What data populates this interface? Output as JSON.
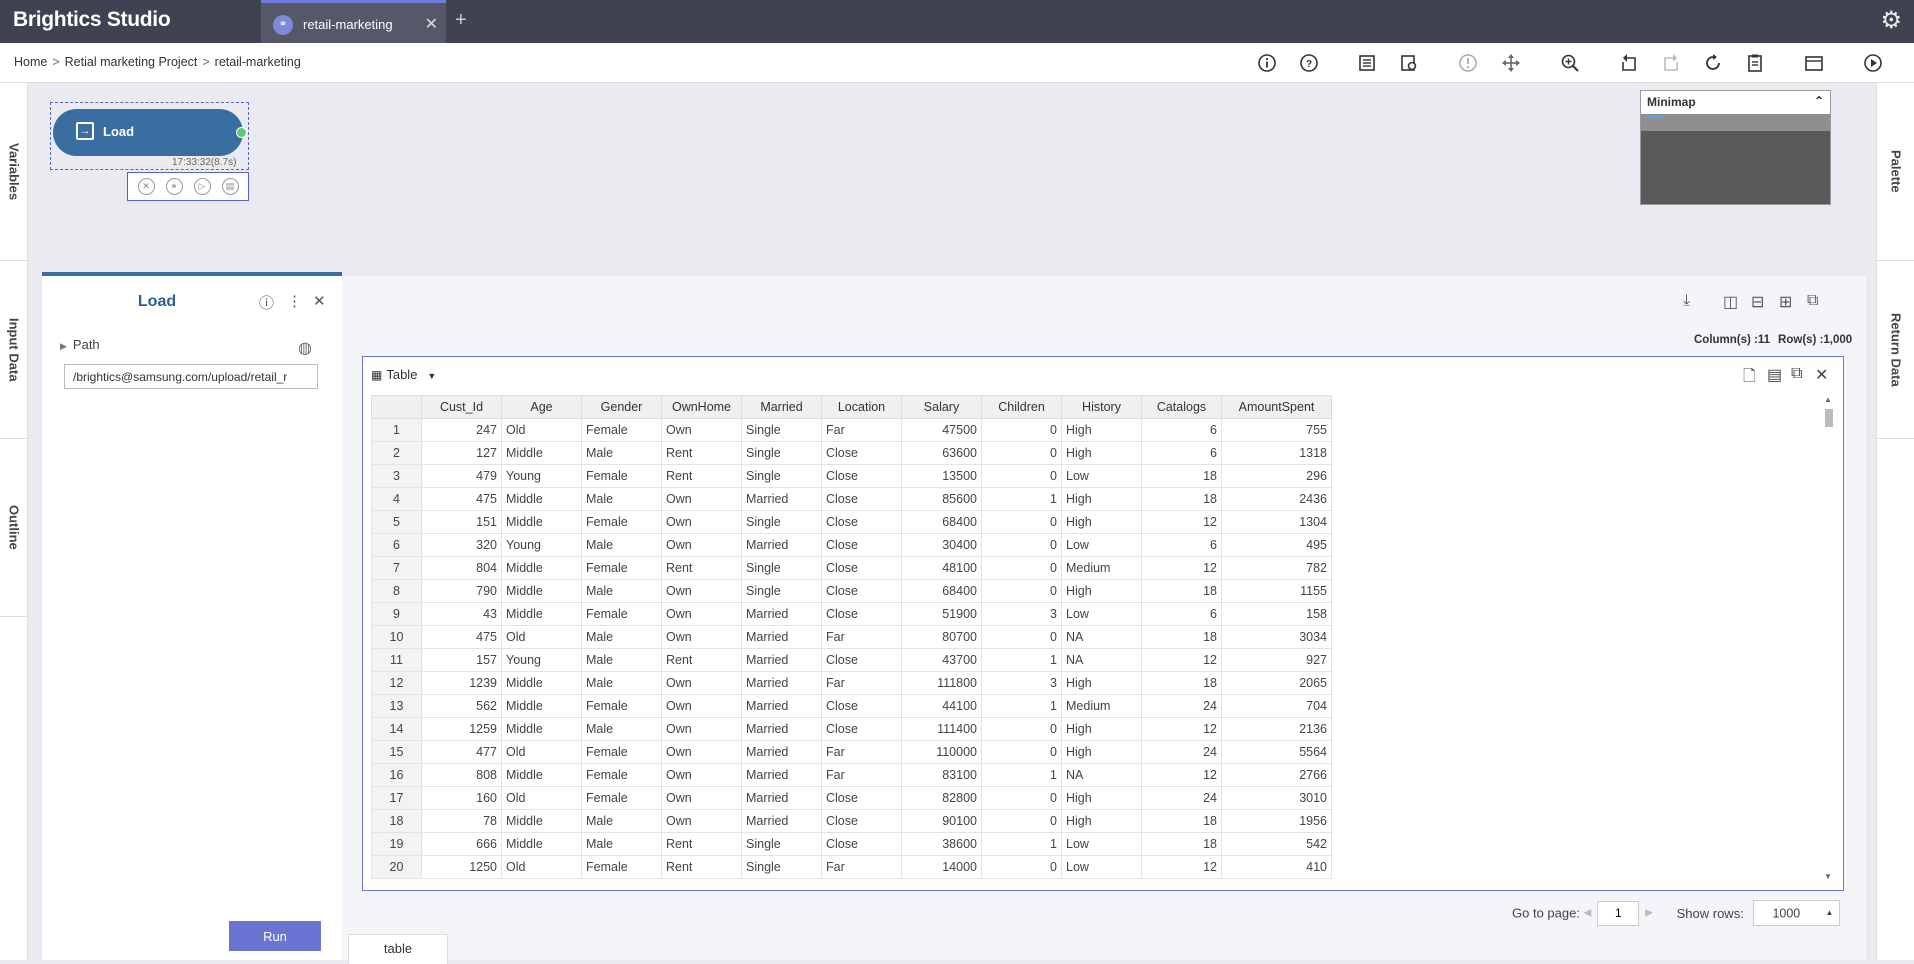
{
  "app": {
    "title": "Brightics Studio"
  },
  "tabs": [
    {
      "label": "retail-marketing",
      "icon": "workflow-icon"
    }
  ],
  "breadcrumb": {
    "home": "Home",
    "project": "Retial marketing Project",
    "current": "retail-marketing"
  },
  "left_rail": [
    "Variables",
    "Input Data",
    "Outline"
  ],
  "right_rail": [
    "Palette",
    "Return Data"
  ],
  "node": {
    "label": "Load",
    "time": "17:33:32(8.7s)"
  },
  "minimap": {
    "title": "Minimap"
  },
  "load_panel": {
    "title": "Load",
    "path_label": "Path",
    "path_value": "/brightics@samsung.com/upload/retail_r",
    "run_label": "Run"
  },
  "result": {
    "columns_label": "Column(s) :11",
    "rows_label": "Row(s) :1,000",
    "view_label": "Table",
    "goto_label": "Go to page:",
    "page_value": "1",
    "show_rows_label": "Show rows:",
    "show_rows_value": "1000",
    "bottom_tab": "table"
  },
  "table": {
    "columns": [
      "Cust_Id",
      "Age",
      "Gender",
      "OwnHome",
      "Married",
      "Location",
      "Salary",
      "Children",
      "History",
      "Catalogs",
      "AmountSpent"
    ],
    "rows": [
      [
        "1",
        "247",
        "Old",
        "Female",
        "Own",
        "Single",
        "Far",
        "47500",
        "0",
        "High",
        "6",
        "755"
      ],
      [
        "2",
        "127",
        "Middle",
        "Male",
        "Rent",
        "Single",
        "Close",
        "63600",
        "0",
        "High",
        "6",
        "1318"
      ],
      [
        "3",
        "479",
        "Young",
        "Female",
        "Rent",
        "Single",
        "Close",
        "13500",
        "0",
        "Low",
        "18",
        "296"
      ],
      [
        "4",
        "475",
        "Middle",
        "Male",
        "Own",
        "Married",
        "Close",
        "85600",
        "1",
        "High",
        "18",
        "2436"
      ],
      [
        "5",
        "151",
        "Middle",
        "Female",
        "Own",
        "Single",
        "Close",
        "68400",
        "0",
        "High",
        "12",
        "1304"
      ],
      [
        "6",
        "320",
        "Young",
        "Male",
        "Own",
        "Married",
        "Close",
        "30400",
        "0",
        "Low",
        "6",
        "495"
      ],
      [
        "7",
        "804",
        "Middle",
        "Female",
        "Rent",
        "Single",
        "Close",
        "48100",
        "0",
        "Medium",
        "12",
        "782"
      ],
      [
        "8",
        "790",
        "Middle",
        "Male",
        "Own",
        "Single",
        "Close",
        "68400",
        "0",
        "High",
        "18",
        "1155"
      ],
      [
        "9",
        "43",
        "Middle",
        "Female",
        "Own",
        "Married",
        "Close",
        "51900",
        "3",
        "Low",
        "6",
        "158"
      ],
      [
        "10",
        "475",
        "Old",
        "Male",
        "Own",
        "Married",
        "Far",
        "80700",
        "0",
        "NA",
        "18",
        "3034"
      ],
      [
        "11",
        "157",
        "Young",
        "Male",
        "Rent",
        "Married",
        "Close",
        "43700",
        "1",
        "NA",
        "12",
        "927"
      ],
      [
        "12",
        "1239",
        "Middle",
        "Male",
        "Own",
        "Married",
        "Far",
        "111800",
        "3",
        "High",
        "18",
        "2065"
      ],
      [
        "13",
        "562",
        "Middle",
        "Female",
        "Own",
        "Married",
        "Close",
        "44100",
        "1",
        "Medium",
        "24",
        "704"
      ],
      [
        "14",
        "1259",
        "Middle",
        "Male",
        "Own",
        "Married",
        "Close",
        "111400",
        "0",
        "High",
        "12",
        "2136"
      ],
      [
        "15",
        "477",
        "Old",
        "Female",
        "Own",
        "Married",
        "Far",
        "110000",
        "0",
        "High",
        "24",
        "5564"
      ],
      [
        "16",
        "808",
        "Middle",
        "Female",
        "Own",
        "Married",
        "Far",
        "83100",
        "1",
        "NA",
        "12",
        "2766"
      ],
      [
        "17",
        "160",
        "Old",
        "Female",
        "Own",
        "Married",
        "Close",
        "82800",
        "0",
        "High",
        "24",
        "3010"
      ],
      [
        "18",
        "78",
        "Middle",
        "Male",
        "Own",
        "Married",
        "Close",
        "90100",
        "0",
        "High",
        "18",
        "1956"
      ],
      [
        "19",
        "666",
        "Middle",
        "Male",
        "Rent",
        "Single",
        "Close",
        "38600",
        "1",
        "Low",
        "18",
        "542"
      ],
      [
        "20",
        "1250",
        "Old",
        "Female",
        "Rent",
        "Single",
        "Far",
        "14000",
        "0",
        "Low",
        "12",
        "410"
      ]
    ]
  },
  "colors": {
    "topbar": "#3f4250",
    "accent": "#6a74d2",
    "node": "#3a6ea1",
    "port": "#5cc870"
  }
}
